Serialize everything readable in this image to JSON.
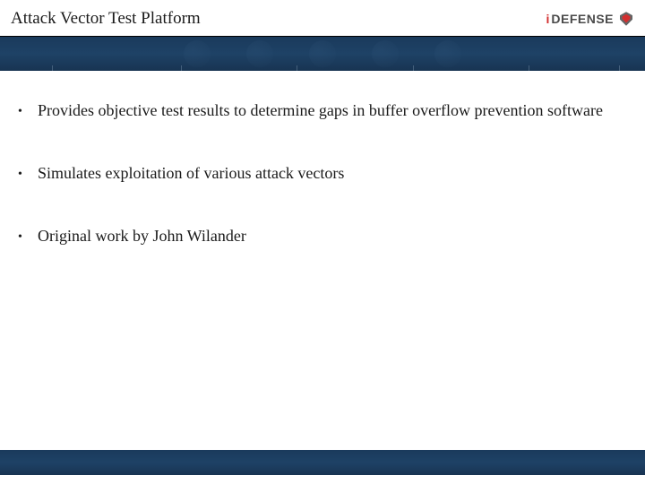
{
  "slide": {
    "title": "Attack Vector Test Platform",
    "logo": {
      "prefix": "i",
      "name": "DEFENSE"
    },
    "bullets": [
      "Provides objective test results to determine gaps in buffer overflow prevention software",
      "Simulates exploitation of various attack vectors",
      "Original work by John Wilander"
    ]
  }
}
